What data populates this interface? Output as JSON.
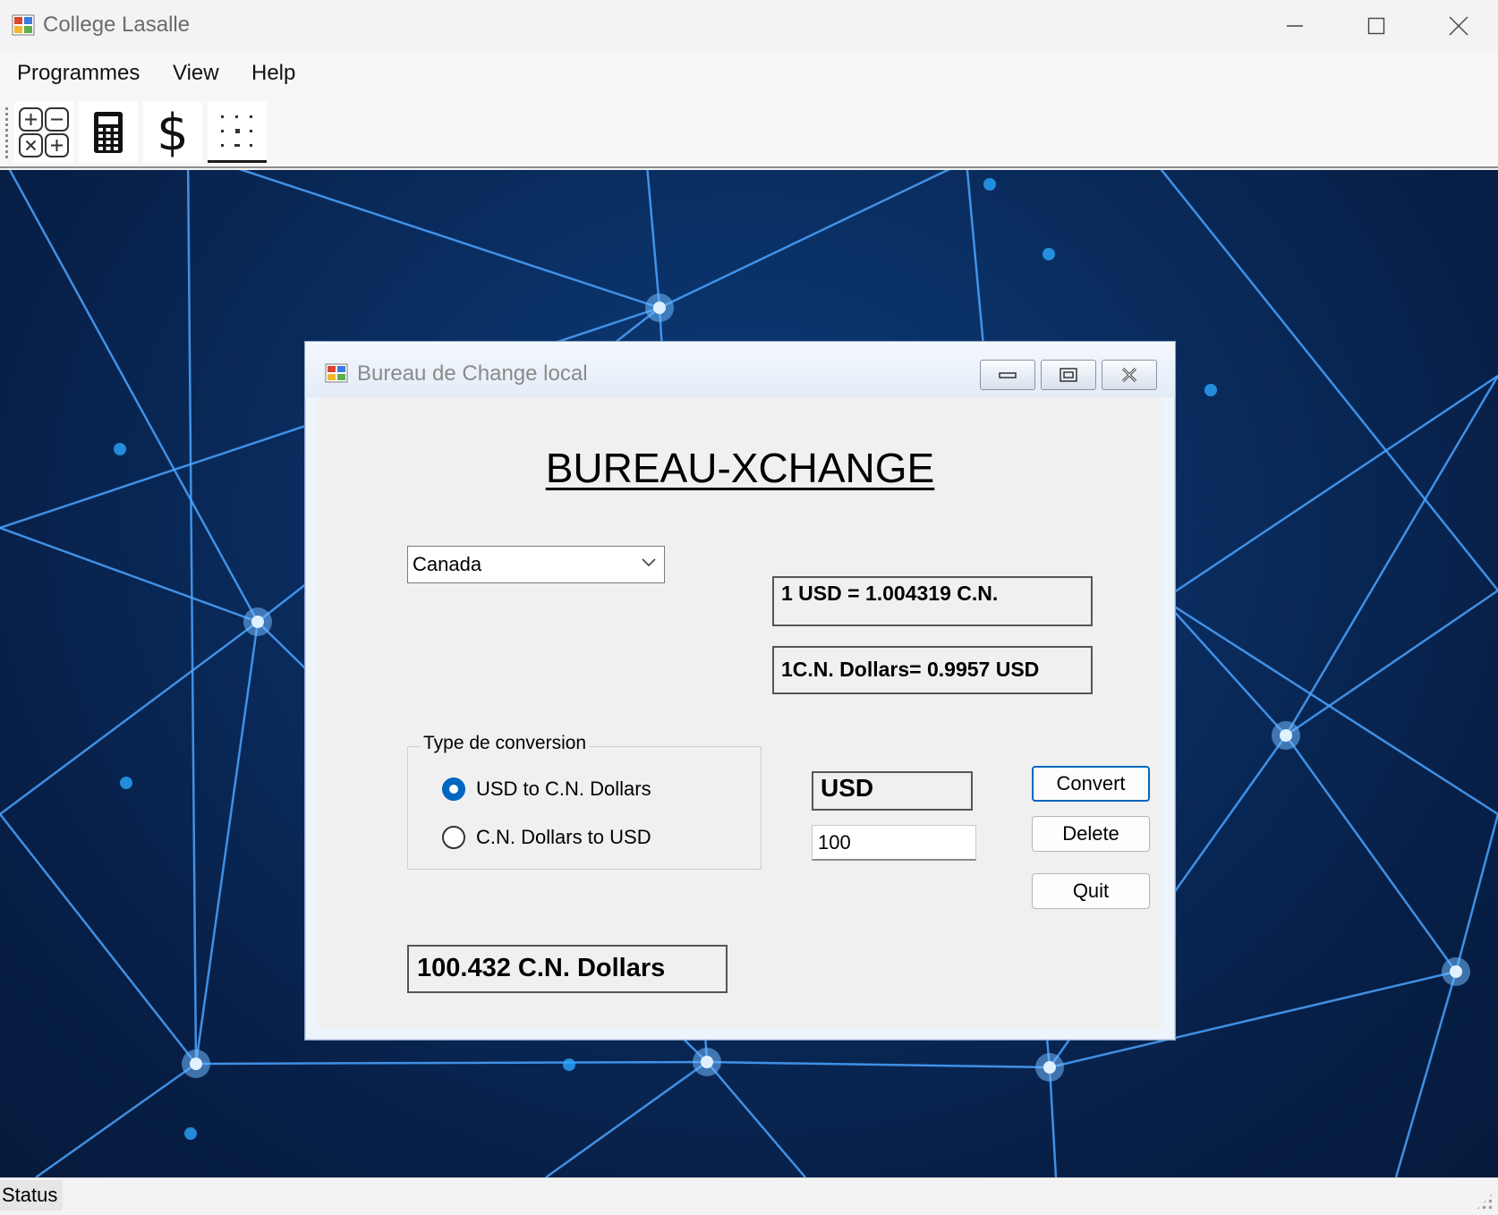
{
  "app": {
    "title": "College Lasalle",
    "icon": "app-window-icon"
  },
  "window_controls": [
    "minimize-icon",
    "maximize-icon",
    "close-icon"
  ],
  "menubar": {
    "items": [
      {
        "label": "Programmes"
      },
      {
        "label": "View"
      },
      {
        "label": "Help"
      }
    ]
  },
  "toolbar": {
    "buttons": [
      {
        "icon": "math-operations-icon"
      },
      {
        "icon": "calculator-icon"
      },
      {
        "icon": "dollar-icon"
      },
      {
        "icon": "dot-grid-icon",
        "selected": true
      }
    ]
  },
  "child_window": {
    "title": "Bureau de Change local",
    "heading": "BUREAU-XCHANGE",
    "country": {
      "selected": "Canada"
    },
    "rate_usd_to_cn": "1 USD = 1.004319 C.N.",
    "rate_cn_to_usd": "1C.N. Dollars= 0.9957 USD",
    "conversion_group": {
      "legend": "Type de conversion",
      "options": [
        {
          "label": "USD to C.N. Dollars",
          "checked": true
        },
        {
          "label": "C.N. Dollars to USD",
          "checked": false
        }
      ]
    },
    "currency_label": "USD",
    "amount_value": "100",
    "buttons": {
      "convert": "Convert",
      "delete": "Delete",
      "quit": "Quit"
    },
    "result": "100.432 C.N. Dollars"
  },
  "statusbar": {
    "label": "Status"
  },
  "colors": {
    "accent": "#0067c0",
    "desktop_bg": "#0a2f63",
    "network_line": "#4aa3ff"
  }
}
